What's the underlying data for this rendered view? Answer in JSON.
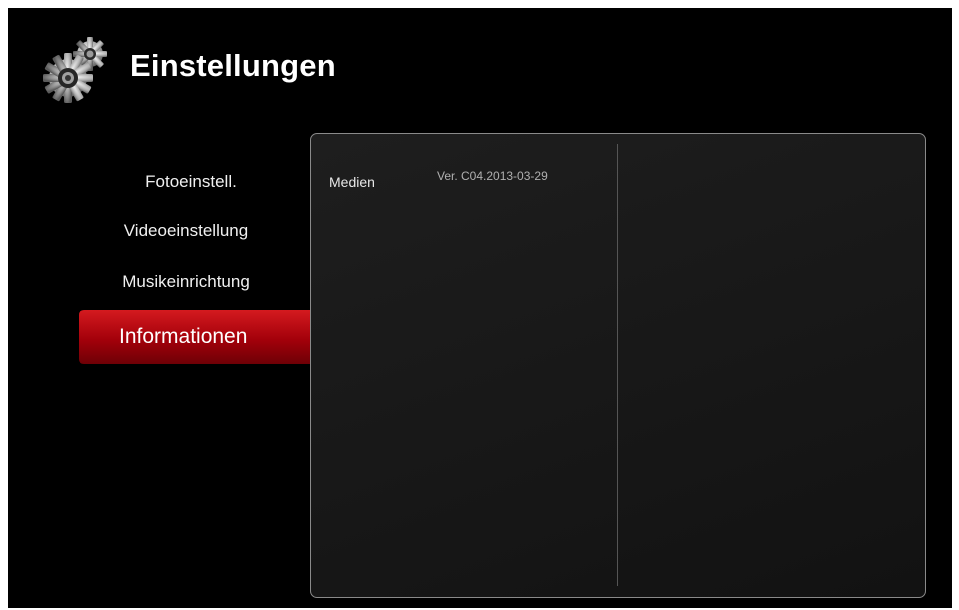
{
  "header": {
    "title": "Einstellungen",
    "icon": "gears-icon"
  },
  "menu": {
    "items": [
      {
        "label": "Fotoeinstell."
      },
      {
        "label": "Videoeinstellung"
      },
      {
        "label": "Musikeinrichtung"
      },
      {
        "label": "Informationen",
        "selected": true
      }
    ]
  },
  "info_panel": {
    "label": "Medien",
    "value": "Ver. C04.2013-03-29"
  },
  "colors": {
    "background": "#000000",
    "selection_accent": "#b3000c",
    "text": "#ffffff"
  }
}
